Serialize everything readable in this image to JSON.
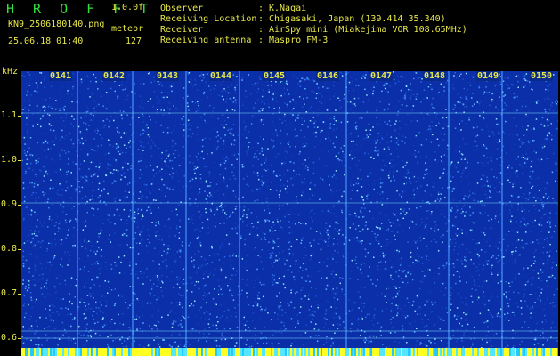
{
  "header": {
    "title": "H R O F F T",
    "version": "1.0.0f",
    "filename": "KN9_2506180140.png",
    "meteor_label": "meteor",
    "timestamp": "25.06.18 01:40",
    "count": "127"
  },
  "info": [
    {
      "label": "Observer",
      "value": "K.Nagai"
    },
    {
      "label": "Receiving Location",
      "value": "Chigasaki, Japan (139.414 35.340)"
    },
    {
      "label": "Receiver",
      "value": "AirSpy mini (Miakejima VOR 108.65MHz)"
    },
    {
      "label": "Receiving antenna",
      "value": "Maspro FM-3"
    }
  ],
  "axis": {
    "y_unit": "kHz",
    "y_ticks": [
      "1.1",
      "1.0",
      "0.9",
      "0.8",
      "0.7",
      "0.6"
    ],
    "time_labels": [
      "0141",
      "0142",
      "0143",
      "0144",
      "0145",
      "0146",
      "0147",
      "0148",
      "0149",
      "0150"
    ]
  },
  "colors": {
    "background": "#000000",
    "header_text": "#e8e84a",
    "title_text": "#2fe03a",
    "spectrogram_base": "#0b2fa8",
    "noise_bright": "#7fe7ff"
  }
}
